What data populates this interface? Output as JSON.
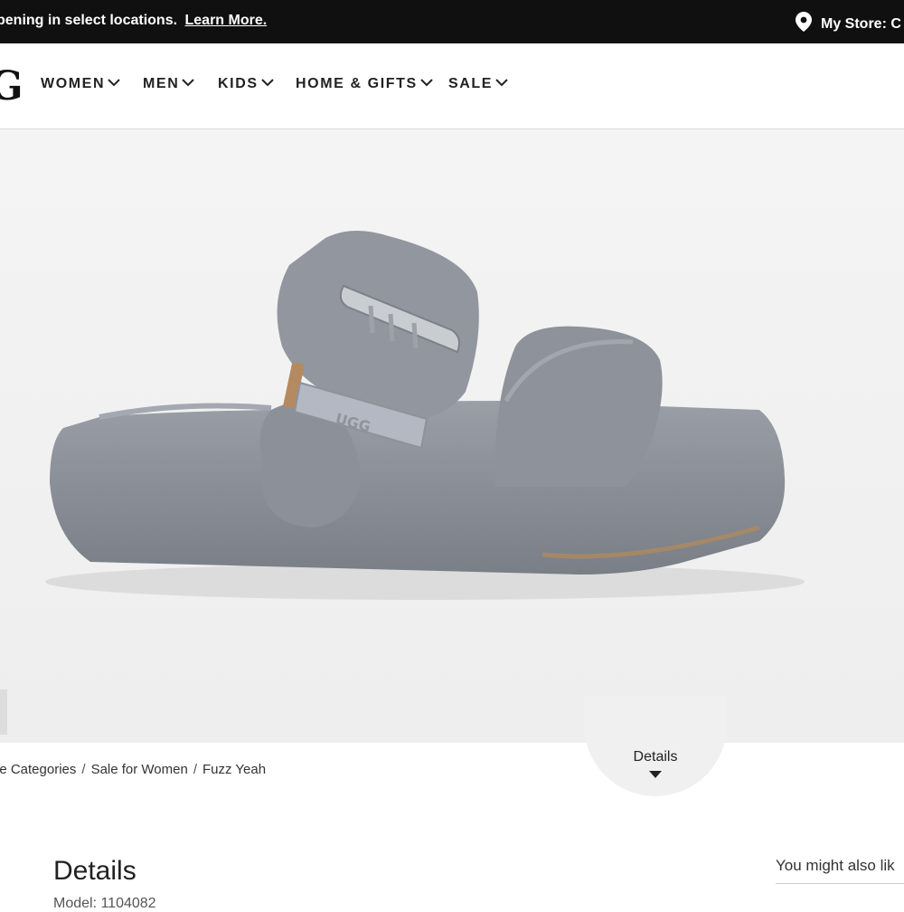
{
  "promo": {
    "text": "pening in select locations.",
    "link": "Learn More."
  },
  "store": {
    "label": "My Store: C",
    "icon": "location-pin-icon"
  },
  "logo": {
    "text": "G"
  },
  "nav": {
    "items": [
      "WOMEN",
      "MEN",
      "KIDS",
      "HOME & GIFTS",
      "SALE"
    ]
  },
  "breadcrumbs": [
    "le Categories",
    "Sale for Women",
    "Fuzz Yeah"
  ],
  "details_tab": {
    "label": "Details"
  },
  "details": {
    "title": "Details",
    "model": "Model: 1104082"
  },
  "sidebar": {
    "also_like": "You might also lik"
  },
  "colors": {
    "promo_bg": "#101010",
    "hero_bg": "#f1f1f1",
    "product": "#8a8e96"
  }
}
